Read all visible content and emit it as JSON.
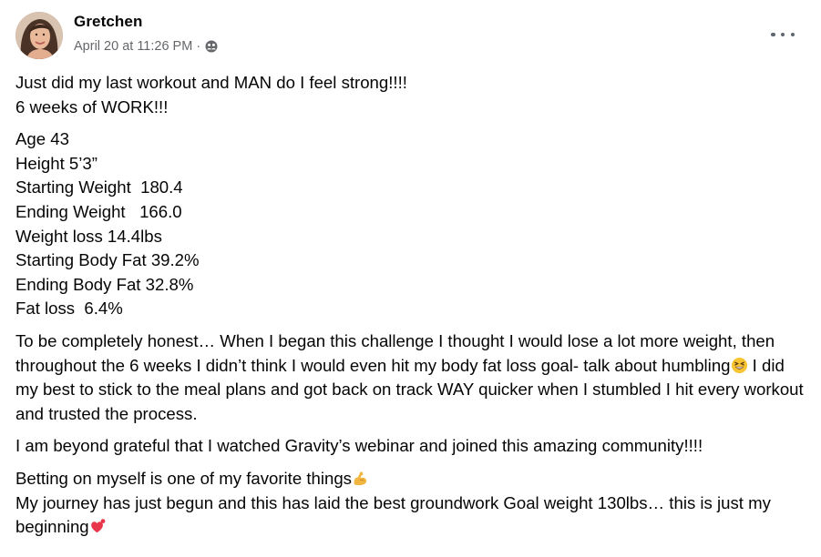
{
  "post": {
    "author": "Gretchen",
    "timestamp": "April 20 at 11:26 PM",
    "separator": "·",
    "privacy_icon": "friends-icon",
    "more_icon": "more-options-icon"
  },
  "content": {
    "p1": [
      "Just did my last workout and MAN do I feel strong!!!!",
      "6 weeks of WORK!!!"
    ],
    "stats": [
      "Age 43",
      "Height 5’3”",
      "Starting Weight  180.4",
      "Ending Weight   166.0",
      "Weight loss 14.4lbs",
      "Starting Body Fat 39.2%",
      "Ending Body Fat 32.8%",
      "Fat loss  6.4%"
    ],
    "p3_a": "To be completely honest… When I began this challenge I thought I would lose a lot more weight, then throughout the 6 weeks I didn’t think I would even hit my body fat loss goal- talk about humbling",
    "p3_b": "  I did my best to stick to the meal plans and got back on track WAY quicker when I stumbled  I hit every workout and trusted the process.",
    "p4": "I am beyond grateful that I watched Gravity’s webinar and joined this amazing community!!!!",
    "p5_a": "Betting on myself is one of my favorite things",
    "p5_b": "My journey has just begun and this has laid the best groundwork   Goal weight 130lbs… this is just my beginning",
    "emojis": {
      "laugh": "grinning-squinting-face-emoji",
      "muscle": "flexed-biceps-emoji",
      "heart": "heart-exclamation-emoji"
    }
  }
}
